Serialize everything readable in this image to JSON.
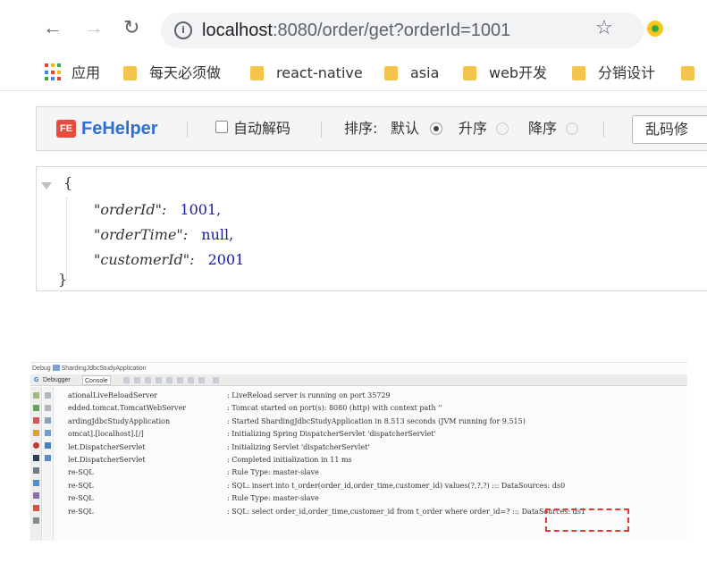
{
  "browser": {
    "url_host": "localhost",
    "url_rest": ":8080/order/get?orderId=1001",
    "bookmarks": [
      {
        "label": "应用",
        "type": "apps"
      },
      {
        "label": "每天必须做",
        "type": "folder"
      },
      {
        "label": "react-native",
        "type": "folder"
      },
      {
        "label": "asia",
        "type": "folder"
      },
      {
        "label": "web开发",
        "type": "folder"
      },
      {
        "label": "分销设计",
        "type": "folder"
      }
    ]
  },
  "fehelper": {
    "name": "FeHelper",
    "logo_text": "FE",
    "auto_decode_label": "自动解码",
    "sort_label": "排序:",
    "sort_default": "默认",
    "sort_asc": "升序",
    "sort_desc": "降序",
    "garble_fix_label": "乱码修"
  },
  "json_view": {
    "open_brace": "{",
    "close_brace": "}",
    "entries": [
      {
        "key": "\"orderId\":",
        "value": "1001,"
      },
      {
        "key": "\"orderTime\":",
        "value": "null,"
      },
      {
        "key": "\"customerId\":",
        "value": "2001"
      }
    ]
  },
  "ide": {
    "title_prefix": "Debug",
    "title_app": "ShardingJdbcStudyApplication",
    "tabs": {
      "debugger": "Debugger",
      "console": "Console"
    },
    "logs": [
      {
        "src": "ationalLiveReloadServer",
        "msg": ": LiveReload server is running on port 35729"
      },
      {
        "src": "edded.tomcat.TomcatWebServer",
        "msg": ": Tomcat started on port(s): 8080 (http) with context path ''"
      },
      {
        "src": "ardingJdbcStudyApplication",
        "msg": ": Started ShardingJdbcStudyApplication in 8.513 seconds (JVM running for 9.515)"
      },
      {
        "src": "omcat].[localhost].[/]",
        "msg": ": Initializing Spring DispatcherServlet 'dispatcherServlet'"
      },
      {
        "src": "let.DispatcherServlet",
        "msg": ": Initializing Servlet 'dispatcherServlet'"
      },
      {
        "src": "let.DispatcherServlet",
        "msg": ": Completed initialization in 11 ms"
      },
      {
        "src": "re-SQL",
        "msg": ": Rule Type: master-slave"
      },
      {
        "src": "re-SQL",
        "msg": ": SQL: insert into t_order(order_id,order_time,customer_id) values(?,?,?) ::: DataSources: ds0"
      },
      {
        "src": "re-SQL",
        "msg": ": Rule Type: master-slave"
      },
      {
        "src": "re-SQL",
        "msg": ": SQL: select order_id,order_time,customer_id from t_order where order_id=? ::: DataSources: ds1"
      }
    ]
  }
}
